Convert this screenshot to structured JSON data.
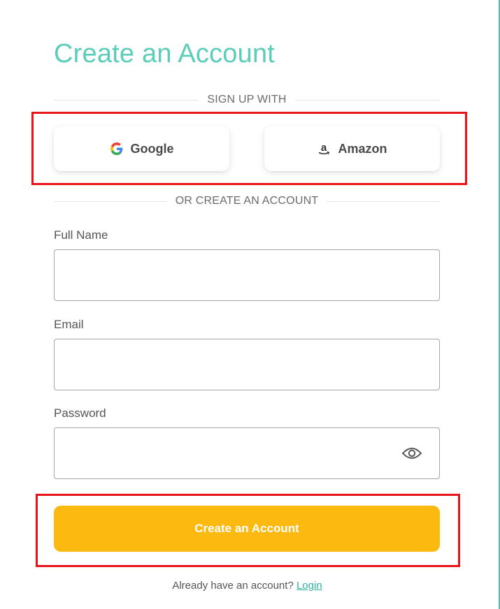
{
  "header": {
    "title": "Create an Account"
  },
  "social": {
    "divider": "SIGN UP WITH",
    "google_label": "Google",
    "amazon_label": "Amazon"
  },
  "form": {
    "divider": "OR CREATE AN ACCOUNT",
    "full_name": {
      "label": "Full Name",
      "value": ""
    },
    "email": {
      "label": "Email",
      "value": ""
    },
    "password": {
      "label": "Password",
      "value": ""
    },
    "submit_label": "Create an Account"
  },
  "footer": {
    "prompt": "Already have an account?",
    "login_link": "Login"
  },
  "colors": {
    "title": "#5ccdb9",
    "primary_button": "#fcb90f",
    "link": "#2fb3a5",
    "highlight": "#e8141a"
  },
  "icons": {
    "google": "google-logo-icon",
    "amazon": "amazon-logo-icon",
    "password_toggle": "eye-icon"
  }
}
